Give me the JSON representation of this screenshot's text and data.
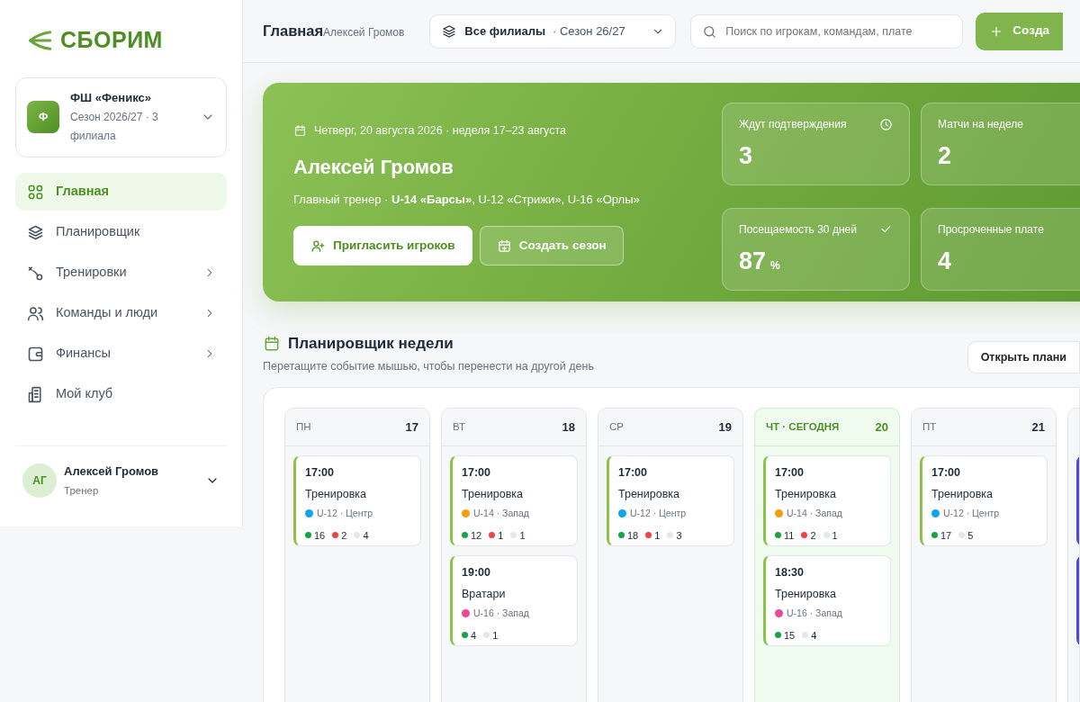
{
  "brand": {
    "name": "СБОРИМ"
  },
  "club": {
    "initial": "Ф",
    "name": "ФШ «Феникс»",
    "meta": "Сезон 2026/27 · 3 филиала"
  },
  "sidebar": {
    "items": [
      {
        "label": "Главная",
        "selected": true,
        "expandable": false
      },
      {
        "label": "Планировщик",
        "selected": false,
        "expandable": false
      },
      {
        "label": "Тренировки",
        "selected": false,
        "expandable": true
      },
      {
        "label": "Команды и люди",
        "selected": false,
        "expandable": true
      },
      {
        "label": "Финансы",
        "selected": false,
        "expandable": true
      },
      {
        "label": "Мой клуб",
        "selected": false,
        "expandable": false
      }
    ]
  },
  "user": {
    "initials": "АГ",
    "name": "Алексей Громов",
    "role": "Тренер"
  },
  "header": {
    "title": "Главная",
    "subtitle": "Алексей Громов",
    "branch": "Все филиалы",
    "season": "· Сезон 26/27",
    "search_placeholder": "Поиск по игрокам, командам, плате",
    "create_button": "Созда"
  },
  "hero": {
    "date": "Четверг, 20 августа 2026 · неделя 17–23 августа",
    "name": "Алексей Громов",
    "role": "Главный тренер · **U-14 «Барсы»**, U-12 «Стрижи», U-16 «Орлы»",
    "buttons": [
      {
        "label": "Пригласить игроков",
        "kind": "primary"
      },
      {
        "label": "Создать сезон",
        "kind": "ghost"
      }
    ],
    "stats": [
      {
        "label": "Ждут подтверждения",
        "value": "3"
      },
      {
        "label": "Матчи на неделе",
        "value": "2"
      },
      {
        "label": "Посещаемость 30 дней",
        "value": "87",
        "unit": "%"
      },
      {
        "label": "Просроченные плате",
        "value": "4"
      }
    ]
  },
  "planner": {
    "title": "Планировщик недели",
    "hint": "Перетащите событие мышью, чтобы перенести на другой день",
    "open_button": "Открыть плани",
    "days": [
      {
        "label": "ПН",
        "date": "17",
        "today": false,
        "events": [
          {
            "kind": "training",
            "time": "17:00",
            "title": "Тренировка",
            "team": "U-12 · Центр",
            "color": "#0ea5e9",
            "counts": [
              {
                "kind": "yes",
                "value": "16"
              },
              {
                "kind": "no",
                "value": "2"
              },
              {
                "kind": "unknown",
                "value": "4"
              }
            ]
          }
        ]
      },
      {
        "label": "ВТ",
        "date": "18",
        "today": false,
        "events": [
          {
            "kind": "training",
            "time": "17:00",
            "title": "Тренировка",
            "team": "U-14 · Запад",
            "color": "#f59e0b",
            "counts": [
              {
                "kind": "yes",
                "value": "12"
              },
              {
                "kind": "no",
                "value": "1"
              },
              {
                "kind": "unknown",
                "value": "1"
              }
            ]
          },
          {
            "kind": "training",
            "time": "19:00",
            "title": "Вратари",
            "team": "U-16 · Запад",
            "color": "#ec4899",
            "counts": [
              {
                "kind": "yes",
                "value": "4"
              },
              {
                "kind": "unknown",
                "value": "1"
              }
            ]
          }
        ]
      },
      {
        "label": "СР",
        "date": "19",
        "today": false,
        "events": [
          {
            "kind": "training",
            "time": "17:00",
            "title": "Тренировка",
            "team": "U-12 · Центр",
            "color": "#0ea5e9",
            "counts": [
              {
                "kind": "yes",
                "value": "18"
              },
              {
                "kind": "no",
                "value": "1"
              },
              {
                "kind": "unknown",
                "value": "3"
              }
            ]
          }
        ]
      },
      {
        "label": "ЧТ · СЕГОДНЯ",
        "date": "20",
        "today": true,
        "events": [
          {
            "kind": "training",
            "time": "17:00",
            "title": "Тренировка",
            "team": "U-14 · Запад",
            "color": "#f59e0b",
            "counts": [
              {
                "kind": "yes",
                "value": "11"
              },
              {
                "kind": "no",
                "value": "2"
              },
              {
                "kind": "unknown",
                "value": "1"
              }
            ]
          },
          {
            "kind": "training",
            "time": "18:30",
            "title": "Тренировка",
            "team": "U-16 · Запад",
            "color": "#ec4899",
            "counts": [
              {
                "kind": "yes",
                "value": "15"
              },
              {
                "kind": "unknown",
                "value": "4"
              }
            ]
          }
        ]
      },
      {
        "label": "ПТ",
        "date": "21",
        "today": false,
        "events": [
          {
            "kind": "training",
            "time": "17:00",
            "title": "Тренировка",
            "team": "U-12 · Центр",
            "color": "#0ea5e9",
            "counts": [
              {
                "kind": "yes",
                "value": "17"
              },
              {
                "kind": "unknown",
                "value": "5"
              }
            ]
          }
        ]
      },
      {
        "today": false,
        "events": [
          {
            "kind": "match"
          },
          {
            "kind": "match"
          }
        ]
      }
    ]
  }
}
